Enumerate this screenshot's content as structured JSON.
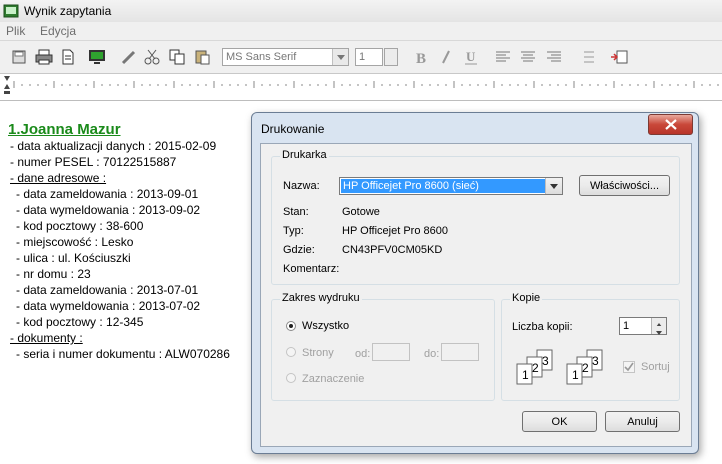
{
  "window": {
    "title": "Wynik zapytania"
  },
  "menu": {
    "items": [
      "Plik",
      "Edycja"
    ]
  },
  "toolbar": {
    "font": "MS Sans Serif",
    "size": "1"
  },
  "document": {
    "heading": "1.Joanna Mazur",
    "lines": [
      "- data aktualizacji danych : 2015-02-09",
      "- numer PESEL : 70122515887",
      "- dane adresowe :",
      "- data zameldowania : 2013-09-01",
      "- data wymeldowania : 2013-09-02",
      "- kod pocztowy : 38-600",
      "- miejscowość : Lesko",
      "- ulica : ul. Kościuszki",
      "- nr domu : 23",
      "- data zameldowania : 2013-07-01",
      "- data wymeldowania : 2013-07-02",
      "- kod pocztowy : 12-345",
      "- dokumenty :",
      "- seria i numer dokumentu : ALW070286"
    ]
  },
  "dialog": {
    "title": "Drukowanie",
    "printer_group": "Drukarka",
    "name_label": "Nazwa:",
    "printer_name": "HP Officejet Pro 8600 (sieć)",
    "properties_button": "Właściwości...",
    "status_label": "Stan:",
    "status_value": "Gotowe",
    "type_label": "Typ:",
    "type_value": "HP Officejet Pro 8600",
    "where_label": "Gdzie:",
    "where_value": "CN43PFV0CM05KD",
    "comment_label": "Komentarz:",
    "range_group": "Zakres wydruku",
    "range_all": "Wszystko",
    "range_pages": "Strony",
    "from_label": "od:",
    "to_label": "do:",
    "range_selection": "Zaznaczenie",
    "copies_group": "Kopie",
    "copies_label": "Liczba kopii:",
    "copies_value": "1",
    "collate_label": "Sortuj",
    "collate_checked": true,
    "ok_button": "OK",
    "cancel_button": "Anuluj"
  }
}
